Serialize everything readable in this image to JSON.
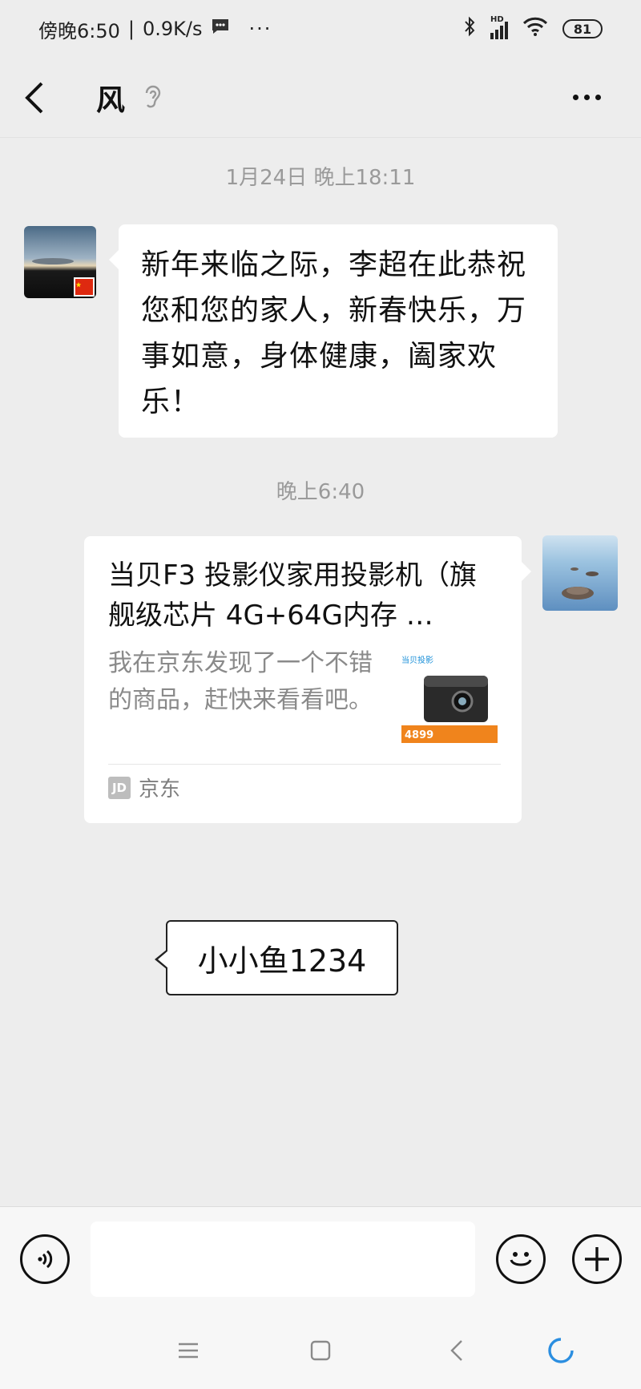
{
  "status_bar": {
    "time": "傍晚6:50",
    "separator": "|",
    "net_speed": "0.9K/s",
    "more": "···",
    "network": "HD",
    "battery": "81"
  },
  "header": {
    "title": "风"
  },
  "messages": [
    {
      "timestamp": "1月24日 晚上18:11",
      "side": "left",
      "text": "新年来临之际，李超在此恭祝您和您的家人，新春快乐，万事如意，身体健康，阖家欢乐！"
    },
    {
      "timestamp": "晚上6:40",
      "side": "right",
      "card": {
        "title": "当贝F3 投影仪家用投影机（旗舰级芯片 4G+64G内存 …",
        "description": "我在京东发现了一个不错的商品，赶快来看看吧。",
        "thumb_brand": "当贝投影",
        "thumb_price": "4899",
        "source_logo": "JD",
        "source": "京东"
      }
    }
  ],
  "tooltip": {
    "text": "小小鱼1234"
  },
  "input": {
    "placeholder": ""
  },
  "colors": {
    "background": "#ededed",
    "bubble": "#ffffff",
    "timestamp": "#9a9a9a"
  }
}
